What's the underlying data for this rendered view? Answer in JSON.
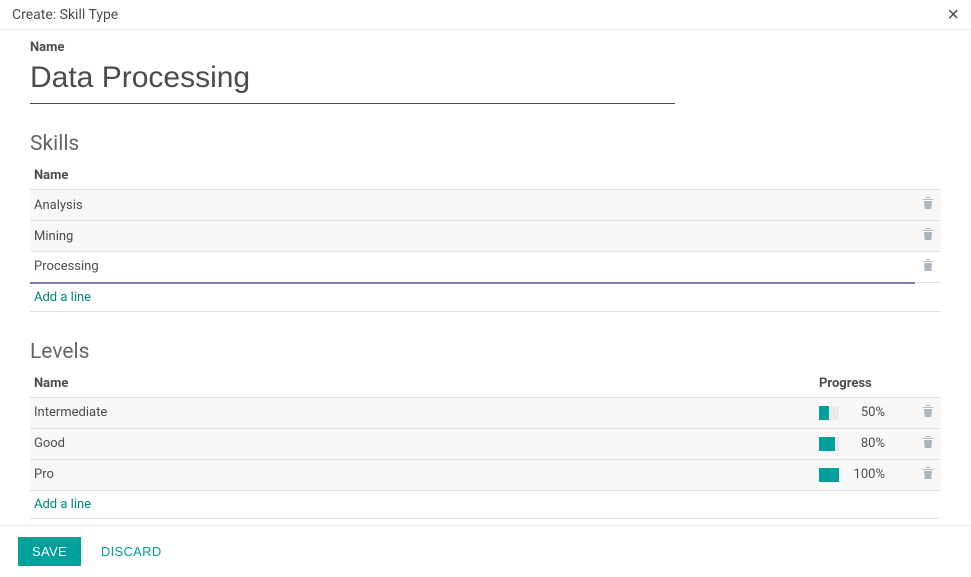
{
  "header": {
    "title": "Create: Skill Type"
  },
  "name_field": {
    "label": "Name",
    "value": "Data Processing"
  },
  "skills_section": {
    "title": "Skills",
    "column_header": "Name",
    "rows": [
      {
        "name": "Analysis"
      },
      {
        "name": "Mining"
      },
      {
        "name": "Processing"
      }
    ],
    "add_line": "Add a line"
  },
  "levels_section": {
    "title": "Levels",
    "columns": {
      "name": "Name",
      "progress": "Progress"
    },
    "rows": [
      {
        "name": "Intermediate",
        "progress": 50
      },
      {
        "name": "Good",
        "progress": 80
      },
      {
        "name": "Pro",
        "progress": 100
      }
    ],
    "add_line": "Add a line"
  },
  "footer": {
    "save": "Save",
    "discard": "Discard"
  },
  "colors": {
    "accent": "#00A09D",
    "link": "#008784"
  }
}
